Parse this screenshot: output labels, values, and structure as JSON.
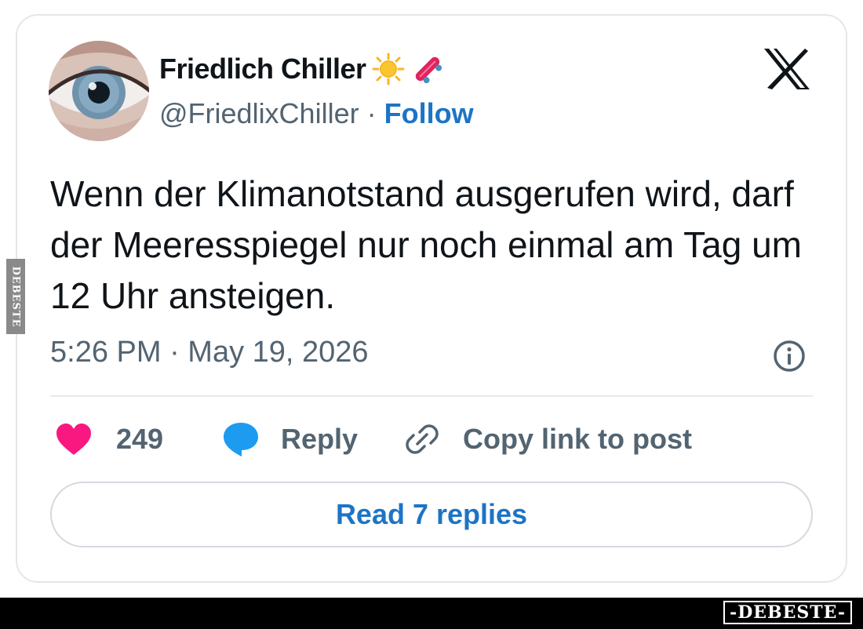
{
  "user": {
    "display_name": "Friedlich Chiller",
    "name_emojis": [
      "sun-icon",
      "skateboard-icon"
    ],
    "handle": "@FriedlixChiller",
    "separator": "·",
    "follow_label": "Follow",
    "avatar": "eye-closeup-avatar"
  },
  "platform_icon": "x-logo-icon",
  "tweet": {
    "text": "Wenn der Klimanotstand ausgerufen wird, darf der Meeresspiegel nur noch einmal am Tag um 12 Uhr ansteigen.",
    "timestamp": "5:26 PM · May 19, 2026"
  },
  "actions": {
    "likes_count": "249",
    "reply_label": "Reply",
    "copy_link_label": "Copy link to post"
  },
  "read_replies_label": "Read 7 replies",
  "watermark": {
    "footer": "-DEBESTE-",
    "side": "DEBESTE"
  },
  "colors": {
    "accent": "#1d74c6",
    "heart": "#f91880",
    "reply_bubble": "#1d9bf0",
    "muted_text": "#536471",
    "sun": "#f8b623",
    "skateboard": "#e0245e"
  }
}
